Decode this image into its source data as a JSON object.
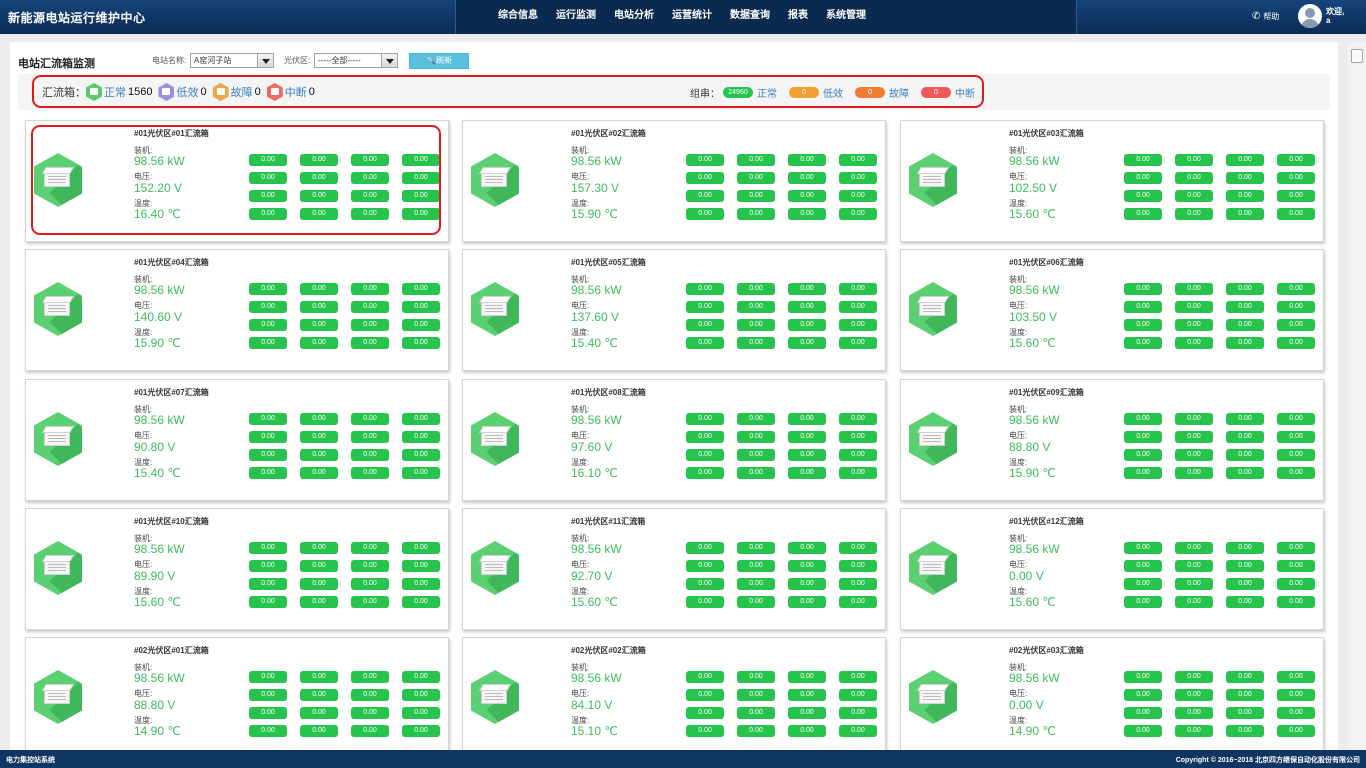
{
  "app": {
    "title": "新能源电站运行维护中心"
  },
  "nav": [
    "综合信息",
    "运行监测",
    "电站分析",
    "运营统计",
    "数据查询",
    "报表",
    "系统管理"
  ],
  "header_right": {
    "help": "帮助",
    "welcome": "欢迎,",
    "user": "a"
  },
  "page": {
    "title": "电站汇流箱监测"
  },
  "filters": {
    "station_label": "电站名称:",
    "station_value": "A窑河子站",
    "area_label": "光伏区:",
    "area_value": "-----全部-----",
    "refresh_label": "刷新"
  },
  "summary": {
    "combiner_label": "汇流箱：",
    "combiner": [
      {
        "label": "正常",
        "count": "1560",
        "color": "#5bc86f"
      },
      {
        "label": "低效",
        "count": "0",
        "color": "#9b8fd6"
      },
      {
        "label": "故障",
        "count": "0",
        "color": "#f0a742"
      },
      {
        "label": "中断",
        "count": "0",
        "color": "#ec6b5e"
      }
    ],
    "string_label": "组串：",
    "strings": [
      {
        "value": "24960",
        "label": "正常",
        "color": "#27c44d"
      },
      {
        "value": "0",
        "label": "低效",
        "color": "#f0a030"
      },
      {
        "value": "0",
        "label": "故障",
        "color": "#ee7d34"
      },
      {
        "value": "0",
        "label": "中断",
        "color": "#ee5a5a"
      }
    ]
  },
  "card_labels": {
    "capacity": "装机:",
    "voltage": "电压:",
    "temperature": "温度:"
  },
  "cards": [
    {
      "name": "#01光伏区#01汇流箱",
      "capacity": "98.56 kW",
      "voltage": "152.20 V",
      "temperature": "16.40 ℃"
    },
    {
      "name": "#01光伏区#02汇流箱",
      "capacity": "98.56 kW",
      "voltage": "157.30 V",
      "temperature": "15.90 ℃"
    },
    {
      "name": "#01光伏区#03汇流箱",
      "capacity": "98.56 kW",
      "voltage": "102.50 V",
      "temperature": "15.60 ℃"
    },
    {
      "name": "#01光伏区#04汇流箱",
      "capacity": "98.56 kW",
      "voltage": "140.60 V",
      "temperature": "15.90 ℃"
    },
    {
      "name": "#01光伏区#05汇流箱",
      "capacity": "98.56 kW",
      "voltage": "137.60 V",
      "temperature": "15.40 ℃"
    },
    {
      "name": "#01光伏区#06汇流箱",
      "capacity": "98.56 kW",
      "voltage": "103.50 V",
      "temperature": "15.60 ℃"
    },
    {
      "name": "#01光伏区#07汇流箱",
      "capacity": "98.56 kW",
      "voltage": "90.80 V",
      "temperature": "15.40 ℃"
    },
    {
      "name": "#01光伏区#08汇流箱",
      "capacity": "98.56 kW",
      "voltage": "97.60 V",
      "temperature": "16.10 ℃"
    },
    {
      "name": "#01光伏区#09汇流箱",
      "capacity": "98.56 kW",
      "voltage": "88.80 V",
      "temperature": "15.90 ℃"
    },
    {
      "name": "#01光伏区#10汇流箱",
      "capacity": "98.56 kW",
      "voltage": "89.90 V",
      "temperature": "15.60 ℃"
    },
    {
      "name": "#01光伏区#11汇流箱",
      "capacity": "98.56 kW",
      "voltage": "92.70 V",
      "temperature": "15.60 ℃"
    },
    {
      "name": "#01光伏区#12汇流箱",
      "capacity": "98.56 kW",
      "voltage": "0.00 V",
      "temperature": "15.60 ℃"
    },
    {
      "name": "#02光伏区#01汇流箱",
      "capacity": "98.56 kW",
      "voltage": "88.80 V",
      "temperature": "14.90 ℃"
    },
    {
      "name": "#02光伏区#02汇流箱",
      "capacity": "98.56 kW",
      "voltage": "84.10 V",
      "temperature": "15.10 ℃"
    },
    {
      "name": "#02光伏区#03汇流箱",
      "capacity": "98.56 kW",
      "voltage": "0.00 V",
      "temperature": "14.90 ℃"
    }
  ],
  "string_cell_value": "0.00",
  "footer": {
    "left": "电力集控站系统",
    "right": "Copyright © 2016~2018 北京四方继保自动化股份有限公司"
  }
}
